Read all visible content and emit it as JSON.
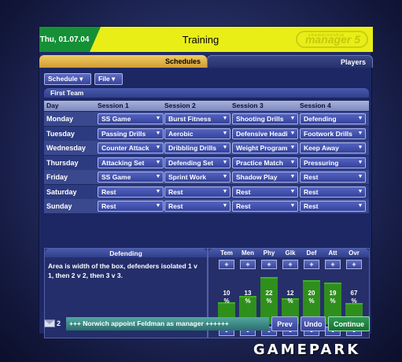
{
  "header": {
    "date": "Thu, 01.07.04",
    "title": "Training",
    "logo_small": "championship",
    "logo_main": "manager 5"
  },
  "tabs": [
    "Schedules",
    "Players"
  ],
  "menus": {
    "schedule": "Schedule ▾",
    "file": "File ▾"
  },
  "section_title": "First Team",
  "table": {
    "columns": [
      "Day",
      "Session 1",
      "Session 2",
      "Session 3",
      "Session 4"
    ],
    "rows": [
      {
        "day": "Monday",
        "sessions": [
          "SS Game",
          "Burst Fitness",
          "Shooting Drills",
          "Defending"
        ]
      },
      {
        "day": "Tuesday",
        "sessions": [
          "Passing Drills",
          "Aerobic",
          "Defensive Heading",
          "Footwork Drills"
        ]
      },
      {
        "day": "Wednesday",
        "sessions": [
          "Counter Attack",
          "Dribbling Drills",
          "Weight Program",
          "Keep Away"
        ]
      },
      {
        "day": "Thursday",
        "sessions": [
          "Attacking Set",
          "Defending Set",
          "Practice Match",
          "Pressuring"
        ]
      },
      {
        "day": "Friday",
        "sessions": [
          "SS Game",
          "Sprint Work",
          "Shadow Play",
          "Rest"
        ]
      },
      {
        "day": "Saturday",
        "sessions": [
          "Rest",
          "Rest",
          "Rest",
          "Rest"
        ]
      },
      {
        "day": "Sunday",
        "sessions": [
          "Rest",
          "Rest",
          "Rest",
          "Rest"
        ]
      }
    ]
  },
  "description": {
    "title": "Defending",
    "text": "Area is width of the box, defenders isolated 1 v 1, then 2 v 2, then 3 v 3."
  },
  "attributes": {
    "plus_label": "+",
    "minus_label": "-",
    "unit": "%",
    "items": [
      {
        "label": "Tem",
        "value": 10
      },
      {
        "label": "Men",
        "value": 13
      },
      {
        "label": "Phy",
        "value": 22
      },
      {
        "label": "Glk",
        "value": 12
      },
      {
        "label": "Def",
        "value": 20
      },
      {
        "label": "Att",
        "value": 19
      },
      {
        "label": "Ovr",
        "value": 67
      }
    ],
    "bar_color": "#2f8f1c"
  },
  "status": {
    "mail_count": "2",
    "news": "+++  Norwich appoint Feldman as manager  ++++++",
    "prev": "Prev",
    "undo": "Undo",
    "continue": "Continue"
  },
  "watermark": "GAMEPARK"
}
